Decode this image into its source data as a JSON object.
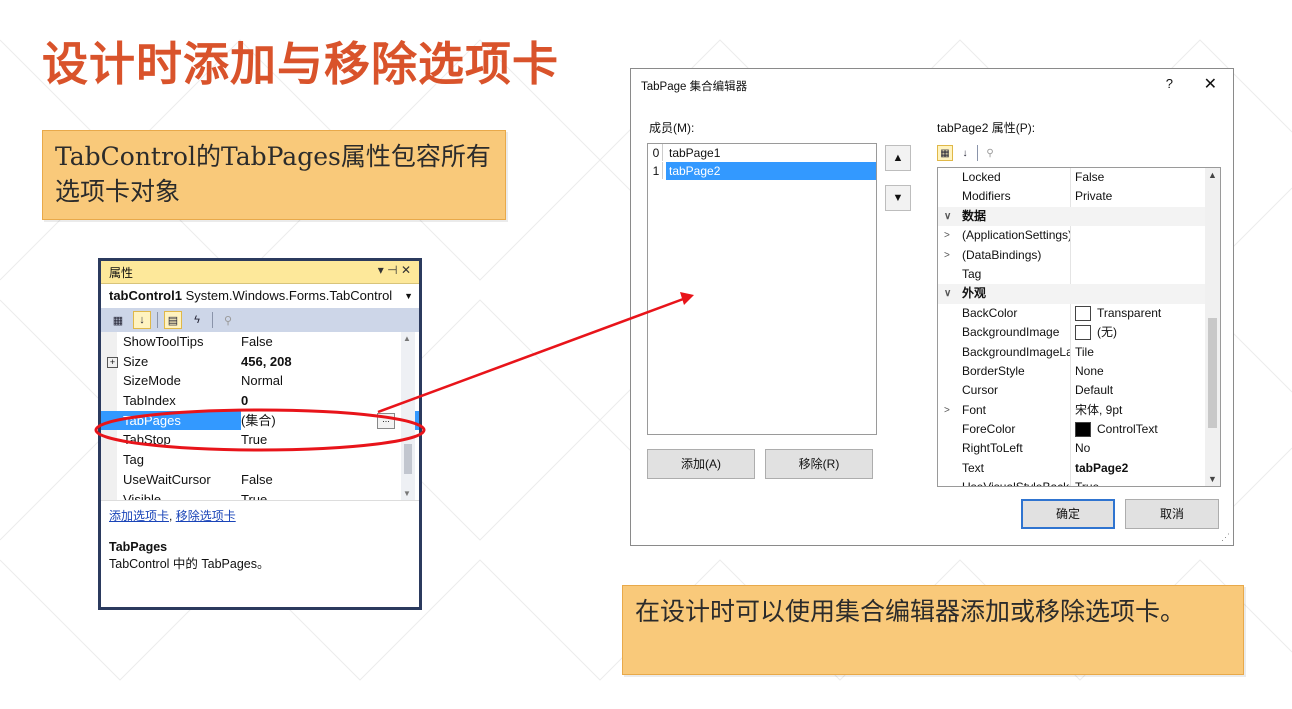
{
  "slide": {
    "title": "设计时添加与移除选项卡",
    "callout_left": "TabControl的TabPages属性包容所有选项卡对象",
    "callout_right": "在设计时可以使用集合编辑器添加或移除选项卡。"
  },
  "properties_panel": {
    "title": "属性",
    "window_controls": "▾ ⊣ ✕",
    "object_name": "tabControl1",
    "object_type": "System.Windows.Forms.TabControl",
    "rows": [
      {
        "label": "ShowToolTips",
        "value": "False",
        "bold": false
      },
      {
        "label": "Size",
        "value": "456, 208",
        "bold": true,
        "expand": "+"
      },
      {
        "label": "SizeMode",
        "value": "Normal",
        "bold": false
      },
      {
        "label": "TabIndex",
        "value": "0",
        "bold": true
      },
      {
        "label": "TabPages",
        "value": "(集合)",
        "bold": false,
        "selected": true,
        "button": "..."
      },
      {
        "label": "TabStop",
        "value": "True",
        "bold": false
      },
      {
        "label": "Tag",
        "value": "",
        "bold": false
      },
      {
        "label": "UseWaitCursor",
        "value": "False",
        "bold": false
      },
      {
        "label": "Visible",
        "value": "True",
        "bold": false
      }
    ],
    "link_add": "添加选项卡",
    "link_remove": "移除选项卡",
    "link_sep": ", ",
    "desc_title": "TabPages",
    "desc_text": "TabControl 中的 TabPages。"
  },
  "dialog": {
    "title": "TabPage 集合编辑器",
    "help": "?",
    "close": "✕",
    "members_label": "成员(M):",
    "members": [
      {
        "index": "0",
        "name": "tabPage1",
        "selected": false
      },
      {
        "index": "1",
        "name": "tabPage2",
        "selected": true
      }
    ],
    "move_up": "▲",
    "move_down": "▼",
    "add_button": "添加(A)",
    "remove_button": "移除(R)",
    "props_label": "tabPage2 属性(P):",
    "prop_rows": [
      {
        "type": "prop",
        "label": "Locked",
        "value": "False"
      },
      {
        "type": "prop",
        "label": "Modifiers",
        "value": "Private"
      },
      {
        "type": "cat",
        "chevron": "∨",
        "label": "数据"
      },
      {
        "type": "prop",
        "chevron": ">",
        "label": "(ApplicationSettings)",
        "value": ""
      },
      {
        "type": "prop",
        "chevron": ">",
        "label": "(DataBindings)",
        "value": ""
      },
      {
        "type": "prop",
        "label": "Tag",
        "value": ""
      },
      {
        "type": "cat",
        "chevron": "∨",
        "label": "外观"
      },
      {
        "type": "prop",
        "label": "BackColor",
        "value": "Transparent",
        "swatch": "#ffffff"
      },
      {
        "type": "prop",
        "label": "BackgroundImage",
        "value": "(无)",
        "swatch": "#ffffff"
      },
      {
        "type": "prop",
        "label": "BackgroundImageLayout",
        "value": "Tile"
      },
      {
        "type": "prop",
        "label": "BorderStyle",
        "value": "None"
      },
      {
        "type": "prop",
        "label": "Cursor",
        "value": "Default"
      },
      {
        "type": "prop",
        "chevron": ">",
        "label": "Font",
        "value": "宋体, 9pt"
      },
      {
        "type": "prop",
        "label": "ForeColor",
        "value": "ControlText",
        "swatch": "#000000"
      },
      {
        "type": "prop",
        "label": "RightToLeft",
        "value": "No"
      },
      {
        "type": "prop",
        "label": "Text",
        "value": "tabPage2",
        "bold": true
      },
      {
        "type": "prop",
        "label": "UseVisualStyleBackColor",
        "value": "True"
      }
    ],
    "ok_button": "确定",
    "cancel_button": "取消"
  },
  "colors": {
    "title": "#d9532b",
    "callout_bg": "#f9c97a",
    "selection": "#3399ff",
    "annotation": "#e8141a"
  }
}
